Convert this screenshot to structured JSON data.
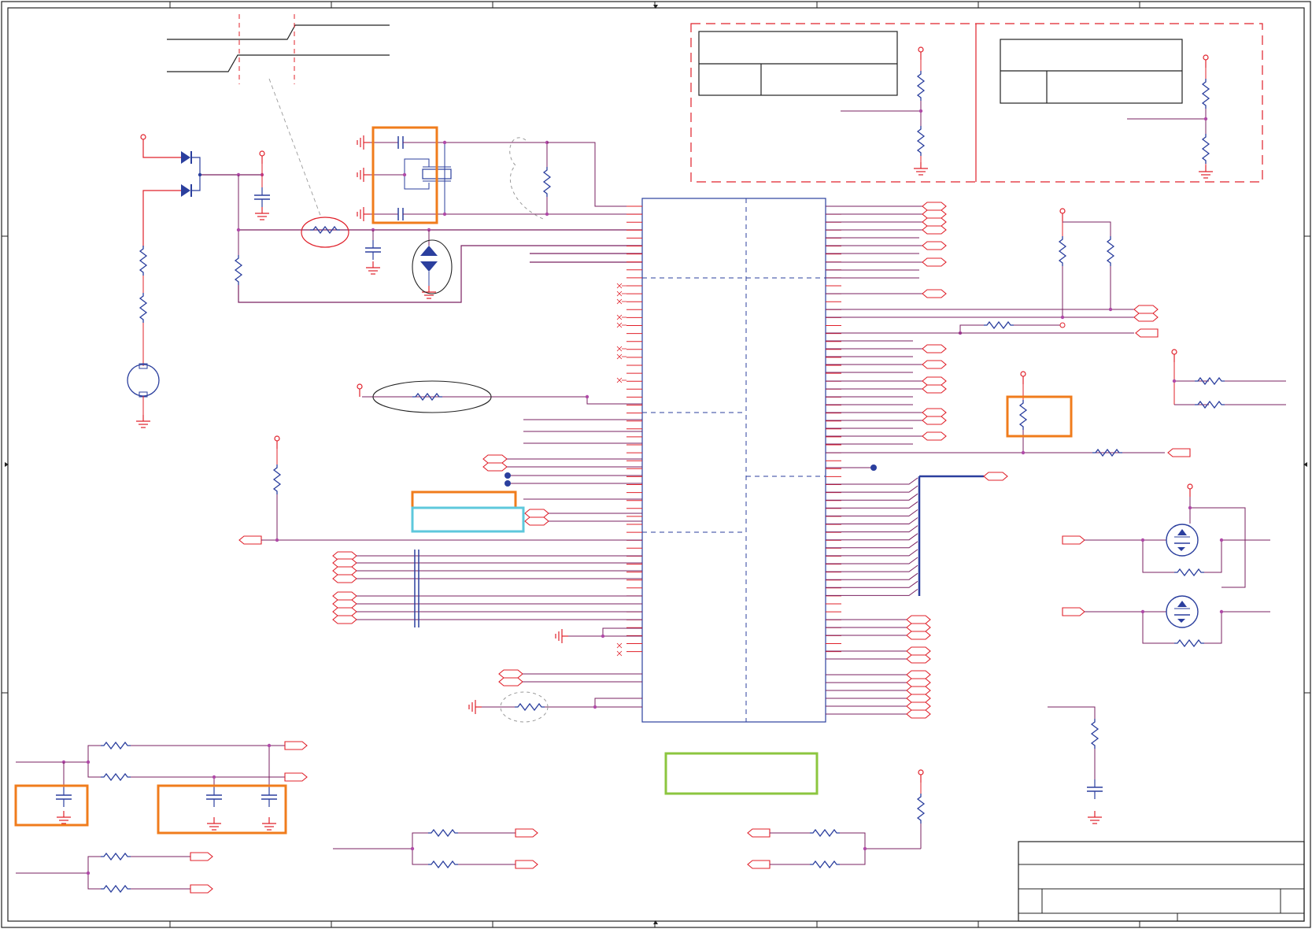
{
  "sheet": {
    "kind": "schematic",
    "colors": {
      "wire_red": "#e0202a",
      "wire_purple": "#7a2060",
      "component_blue": "#2b3f9e",
      "frame_black": "#222222",
      "highlight_orange": "#f07c1c",
      "highlight_cyan": "#5ec8dc",
      "highlight_green": "#8cc63f",
      "dashed_red": "#e0202a",
      "annotation_gray": "#9a9a9a"
    }
  },
  "frame": {
    "zone_ticks_top": 8,
    "zone_ticks_side": 3
  },
  "chip": {
    "left_pins": 57,
    "right_pins": 57
  },
  "title_block": {
    "rows": 3
  },
  "highlights": [
    {
      "name": "crystal-highlight",
      "color": "orange"
    },
    {
      "name": "pullup-highlight",
      "color": "orange"
    },
    {
      "name": "pin-label-highlight",
      "color": "orange"
    },
    {
      "name": "pin-label-highlight-2",
      "color": "cyan"
    },
    {
      "name": "cap-highlight-left",
      "color": "orange"
    },
    {
      "name": "cap-highlight-pair",
      "color": "orange"
    },
    {
      "name": "note-highlight",
      "color": "green"
    }
  ],
  "icons": [
    "diode-icon",
    "resistor-icon",
    "capacitor-icon",
    "crystal-icon",
    "mosfet-icon",
    "battery-icon",
    "ground-icon",
    "power-rail-icon",
    "port-connector-icon"
  ]
}
